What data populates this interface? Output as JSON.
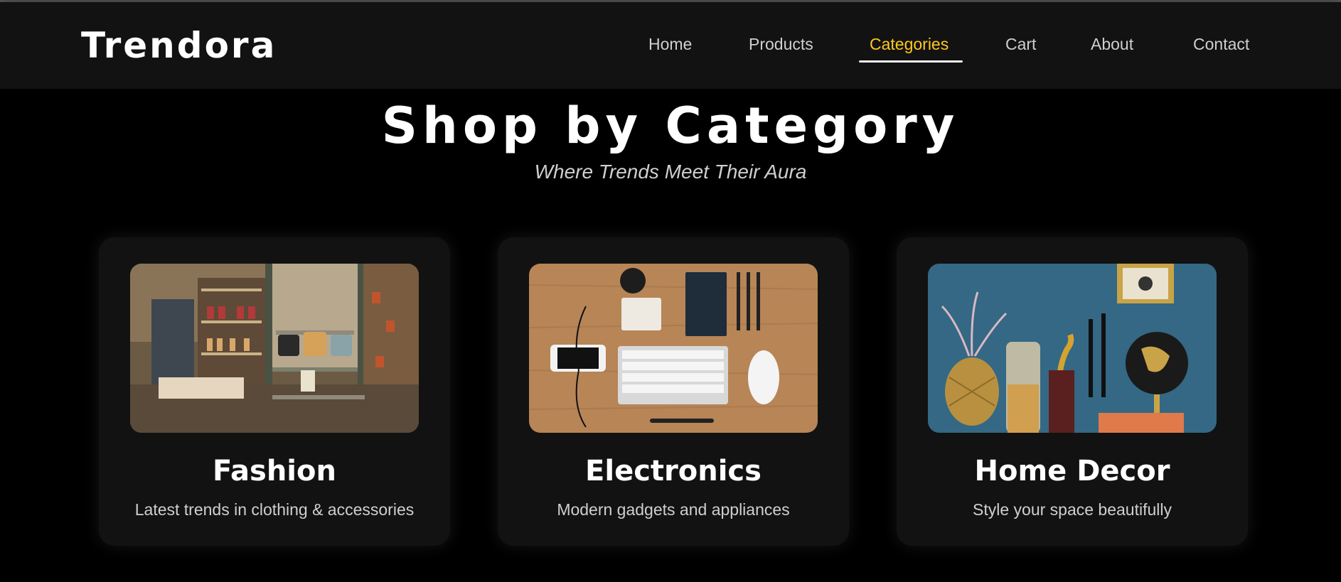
{
  "brand": "Trendora",
  "nav": [
    {
      "label": "Home",
      "active": false
    },
    {
      "label": "Products",
      "active": false
    },
    {
      "label": "Categories",
      "active": true
    },
    {
      "label": "Cart",
      "active": false
    },
    {
      "label": "About",
      "active": false
    },
    {
      "label": "Contact",
      "active": false
    }
  ],
  "hero": {
    "title": "Shop by Category",
    "subtitle": "Where Trends Meet Their Aura"
  },
  "categories": [
    {
      "title": "Fashion",
      "description": "Latest trends in clothing & accessories",
      "image": "boutique-store-photo"
    },
    {
      "title": "Electronics",
      "description": "Modern gadgets and appliances",
      "image": "desk-gadgets-photo"
    },
    {
      "title": "Home Decor",
      "description": "Style your space beautifully",
      "image": "decor-shelf-photo"
    }
  ],
  "colors": {
    "background": "#000000",
    "navbar": "#121212",
    "card": "#121212",
    "accent": "#ffc81e",
    "text": "#ffffff",
    "muted": "#cfcfcf"
  }
}
